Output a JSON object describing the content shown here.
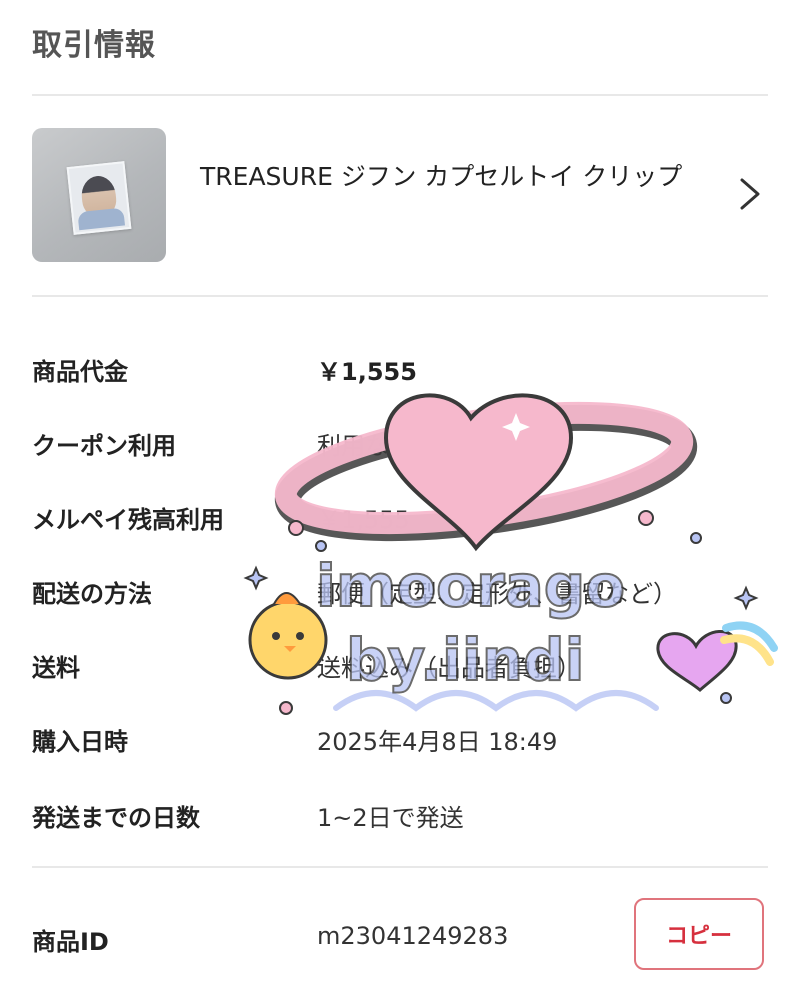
{
  "section": {
    "title": "取引情報"
  },
  "product": {
    "name": "TREASURE ジフン カプセルトイ クリップ",
    "thumbnail_icon": "product-photo"
  },
  "details": [
    {
      "label": "商品代金",
      "value": "￥1,555"
    },
    {
      "label": "クーポン利用",
      "value": "利用なし"
    },
    {
      "label": "メルペイ残高利用",
      "value": "￥1,555"
    },
    {
      "label": "配送の方法",
      "value": "郵便（定型、定形外、書留など）"
    },
    {
      "label": "送料",
      "value": "送料込み（出品者負担）"
    },
    {
      "label": "購入日時",
      "value": "2025年4月8日 18:49"
    },
    {
      "label": "発送までの日数",
      "value": "1~2日で発送"
    }
  ],
  "product_id": {
    "label": "商品ID",
    "value": "m23041249283",
    "copy_label": "コピー"
  },
  "watermark": {
    "line1": "imoorago",
    "line2": "by.iindi"
  },
  "colors": {
    "accent": "#d6303e",
    "divider": "#e8e8e8",
    "sticker_pink": "#f6b8cc",
    "sticker_blue": "#b8c4f4"
  }
}
